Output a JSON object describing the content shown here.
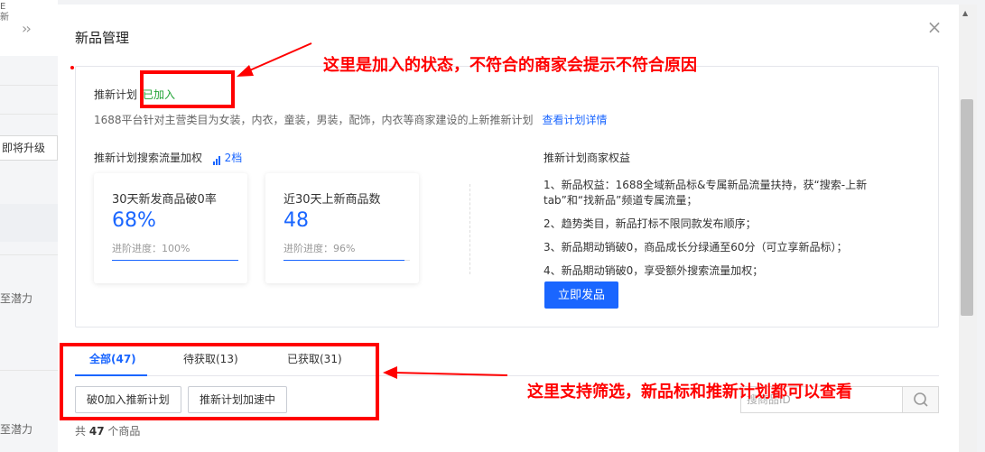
{
  "sidebar": {
    "top_text": "E\n新",
    "expand_icon": "chevrons-right-icon",
    "upgrade_label": "即将升级",
    "potential_label_1": "至潜力",
    "potential_label_2": "至潜力"
  },
  "modal": {
    "title": "新品管理",
    "close_icon": "close-icon",
    "plan": {
      "label": "推新计划",
      "status": "已加入",
      "status_color": "#21a336",
      "description": "1688平台针对主营类目为女装，内衣，童装，男装，配饰，内衣等商家建设的上新推新计划",
      "detail_link": "查看计划详情"
    },
    "flow": {
      "title": "推新计划搜索流量加权",
      "level": "2档",
      "level_icon": "signal-bars-icon"
    },
    "stats": [
      {
        "label": "30天新发商品破0率",
        "value": "68%",
        "progress_text": "进阶进度：100%",
        "progress": 1.0
      },
      {
        "label": "近30天上新商品数",
        "value": "48",
        "progress_text": "进阶进度：96%",
        "progress": 0.96
      }
    ],
    "benefits": {
      "title": "推新计划商家权益",
      "items": [
        "1、新品权益：1688全域新品标&专属新品流量扶持，获“搜索-上新tab”和“找新品”频道专属流量；",
        "2、趋势类目，新品打标不限同款发布顺序；",
        "3、新品期动销破0，商品成长分绿通至60分（可立享新品标）；",
        "4、新品期动销破0，享受额外搜索流量加权；"
      ],
      "publish_button": "立即发品"
    },
    "tabs": [
      {
        "label": "全部(47)",
        "active": true
      },
      {
        "label": "待获取(13)",
        "active": false
      },
      {
        "label": "已获取(31)",
        "active": false
      }
    ],
    "filters": [
      "破0加入推新计划",
      "推新计划加速中"
    ],
    "search": {
      "placeholder": "搜商品ID",
      "icon": "search-icon"
    },
    "count": {
      "prefix": "共",
      "number": "47",
      "suffix": "个商品"
    }
  },
  "annotations": {
    "top_note": "这里是加入的状态，不符合的商家会提示不符合原因",
    "bottom_note": "这里支持筛选，新品标和推新计划都可以查看",
    "color": "#ff0000"
  },
  "colors": {
    "accent": "#1a66ff",
    "success": "#21a336"
  }
}
